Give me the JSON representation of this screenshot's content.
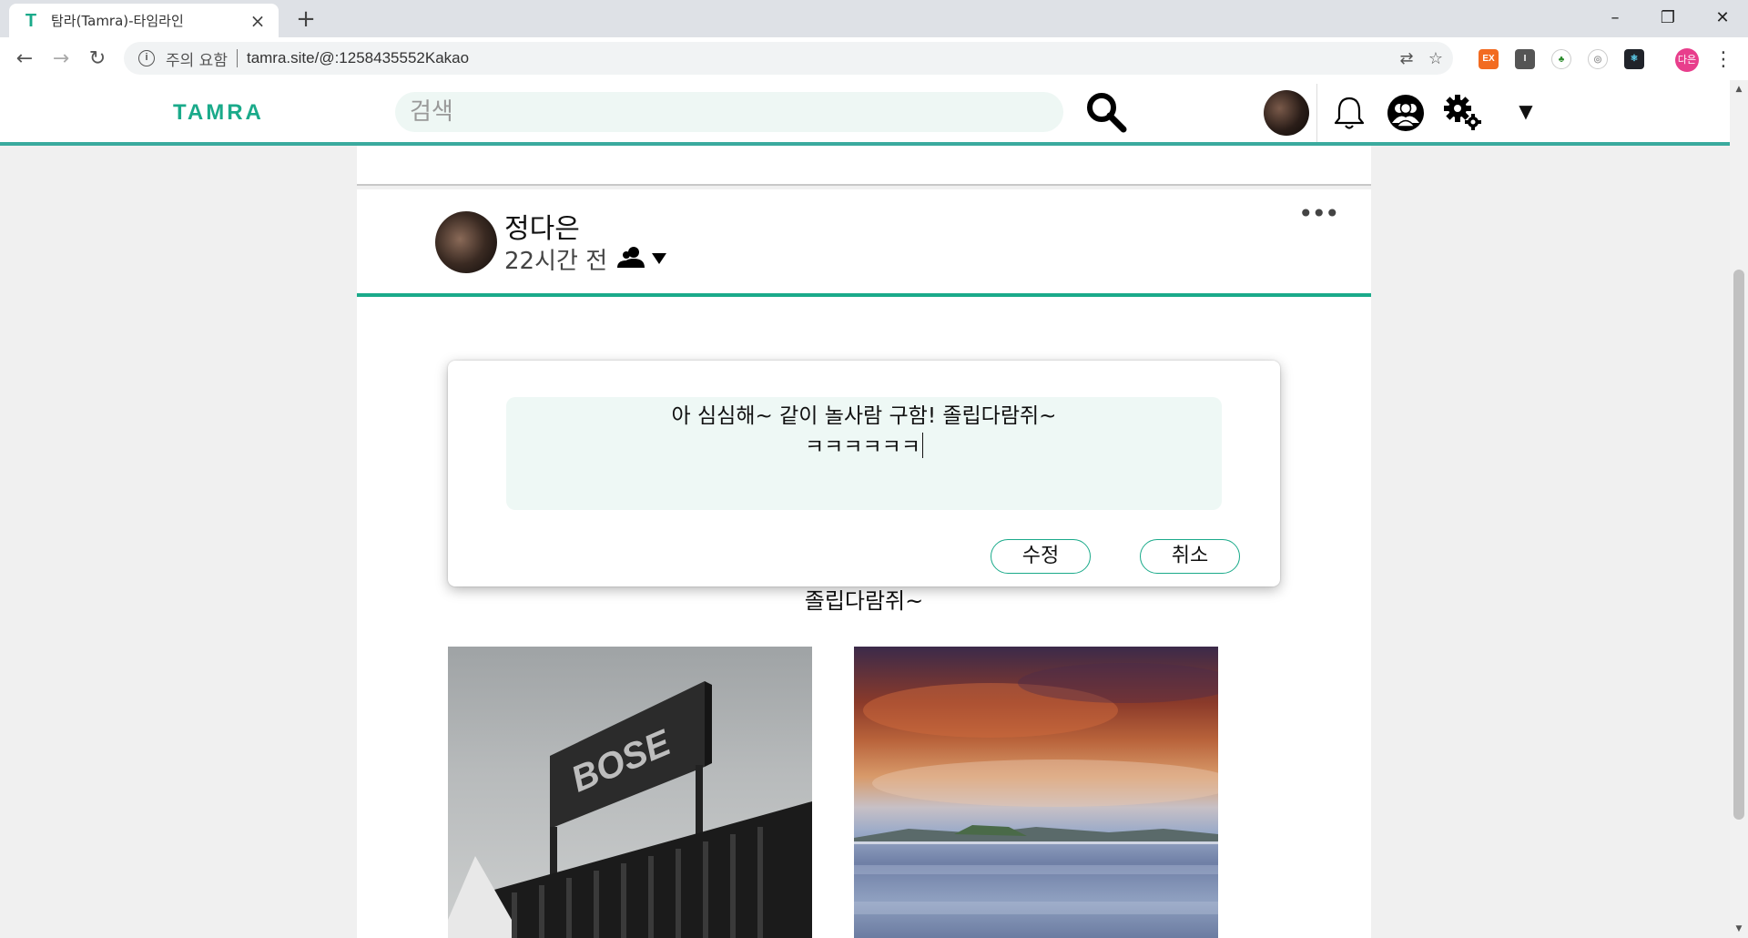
{
  "browser": {
    "tab_title": "탐라(Tamra)-타임라인",
    "favicon_letter": "T",
    "security_label": "주의 요함",
    "url": "tamra.site/@:1258435552Kakao",
    "profile_initials": "다은",
    "extensions": [
      "translate-icon",
      "star-icon",
      "ex-extension-icon",
      "i-extension-icon",
      "green-extension-icon",
      "circle-extension-icon",
      "react-extension-icon"
    ]
  },
  "site": {
    "logo": "TAMRA",
    "search_placeholder": "검색",
    "accent_color": "#1aaa8a"
  },
  "post": {
    "author": "정다은",
    "time": "22시간 전",
    "text_partial": "졸립다람쥐~",
    "photos": [
      "photo-bose-stage",
      "photo-sunset-lake"
    ]
  },
  "edit": {
    "line1": "아 심심해~ 같이 놀사람 구함! 졸립다람쥐~",
    "line2": "ㅋㅋㅋㅋㅋㅋ",
    "save_label": "수정",
    "cancel_label": "취소"
  }
}
